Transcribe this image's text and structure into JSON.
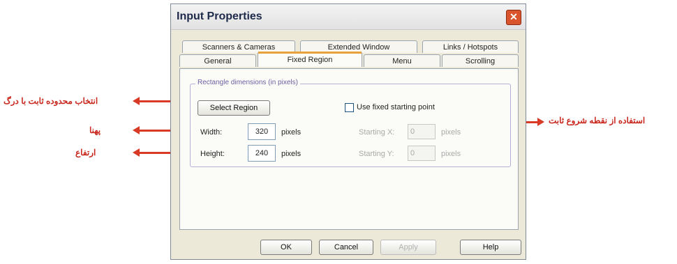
{
  "dialog": {
    "title": "Input Properties",
    "close_glyph": "✕",
    "tabs_back": [
      "Scanners & Cameras",
      "Extended Window",
      "Links / Hotspots"
    ],
    "tabs_front": [
      "General",
      "Fixed Region",
      "Menu",
      "Scrolling"
    ],
    "active_tab": "Fixed Region",
    "group_label": "Rectangle dimensions (in pixels)",
    "select_region_label": "Select Region",
    "use_fixed_label": "Use fixed starting point",
    "use_fixed_checked": false,
    "width_label": "Width:",
    "width_value": "320",
    "height_label": "Height:",
    "height_value": "240",
    "unit_label": "pixels",
    "start_x_label": "Starting X:",
    "start_x_value": "0",
    "start_y_label": "Starting Y:",
    "start_y_value": "0",
    "ok_label": "OK",
    "cancel_label": "Cancel",
    "apply_label": "Apply",
    "help_label": "Help"
  },
  "annotations": {
    "select_region": "انتخاب محدوده ثابت با درگ",
    "width": "پهنا",
    "height": "ارتفاع",
    "fixed_start": "استفاده از نقطه شروع ثابت"
  },
  "colors": {
    "arrow": "#d83a26",
    "annotation_text": "#c8281e",
    "tab_highlight": "#e9a13b"
  }
}
